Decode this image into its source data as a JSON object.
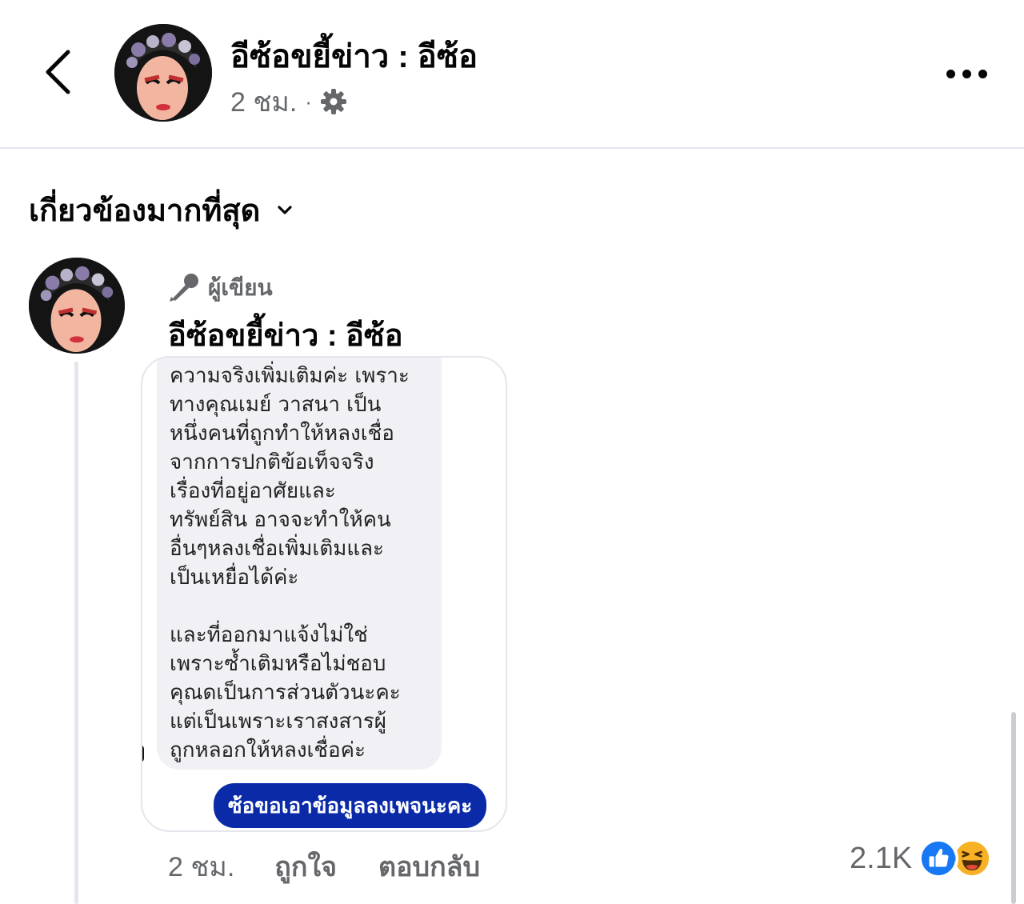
{
  "header": {
    "page_name": "อีซ้อขยี้ข่าว : อีซ้อ",
    "timestamp": "2 ชม.",
    "separator": "·",
    "privacy_icon": "gear-icon",
    "back_icon": "chevron-left-icon",
    "more_icon": "more-horizontal-icon"
  },
  "sort": {
    "label": "เกี่ยวข้องมากที่สุด",
    "icon": "chevron-down-icon"
  },
  "comment": {
    "badge_label": "ผู้เขียน",
    "badge_icon": "microphone-icon",
    "author_name": "อีซ้อขยี้ข่าว : อีซ้อ",
    "attachment": {
      "received_message": "ความจริงเพิ่มเติมค่ะ เพราะ\nทางคุณเมย์ วาสนา เป็น\nหนึ่งคนที่ถูกทำให้หลงเชื่อ\nจากการปกติข้อเท็จจริง\nเรื่องที่อยู่อาศัยและ\nทรัพย์สิน อาจจะทำให้คน\nอื่นๆหลงเชื่อเพิ่มเติมและ\nเป็นเหยื่อได้ค่ะ\n\nและที่ออกมาแจ้งไม่ใช่\nเพราะซ้ำเติมหรือไม่ชอบ\nคุณดเป็นการส่วนตัวนะคะ\nแต่เป็นเพราะเราสงสารผู้\nถูกหลอกให้หลงเชื่อค่ะ",
      "sent_message": "ซ้อขอเอาข้อมูลลงเพจนะคะ"
    },
    "time": "2 ชม.",
    "like_label": "ถูกใจ",
    "reply_label": "ตอบกลับ",
    "reaction_count": "2.1K",
    "reaction_icons": [
      "like-icon",
      "haha-icon"
    ],
    "colors": {
      "like": "#1877f2",
      "haha": "#f7b125",
      "sent_bubble": "#0a2aa8"
    }
  }
}
